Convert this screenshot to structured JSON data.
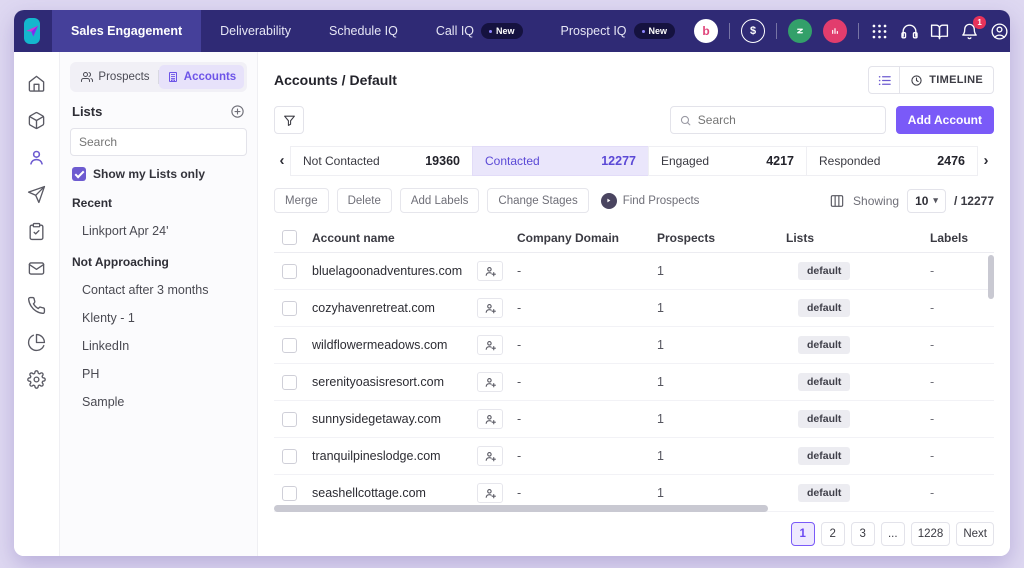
{
  "colors": {
    "accent": "#7a5af8",
    "navbar": "#2f2a75",
    "active_stage_text": "#5b49d6",
    "notification_red": "#e8335a"
  },
  "icon_names": [
    "paper-plane-logo",
    "dollar-icon",
    "zigzag-icon",
    "bars-icon",
    "grid-icon",
    "headset-icon",
    "book-icon",
    "bell-icon",
    "user-icon",
    "home-icon",
    "package-icon",
    "person-icon",
    "send-icon",
    "clipboard-icon",
    "mail-icon",
    "phone-icon",
    "pie-chart-icon",
    "gear-icon",
    "users-icon",
    "building-icon",
    "plus-circle-icon",
    "filter-icon",
    "search-icon",
    "list-view-icon",
    "clock-icon",
    "play-icon",
    "columns-icon",
    "user-plus-icon",
    "chevron-left-icon",
    "chevron-right-icon",
    "caret-down-icon"
  ],
  "topnav": {
    "items": [
      {
        "label": "Sales Engagement"
      },
      {
        "label": "Deliverability"
      },
      {
        "label": "Schedule IQ"
      },
      {
        "label": "Call IQ",
        "badge": "New"
      },
      {
        "label": "Prospect IQ",
        "badge": "New"
      }
    ],
    "apps": {
      "brand_letter": "b",
      "dollar": "$"
    },
    "notification_count": "1"
  },
  "sidebar": {
    "tabs": {
      "prospects": "Prospects",
      "accounts": "Accounts"
    },
    "lists_title": "Lists",
    "search_placeholder": "Search",
    "show_my_lists_label": "Show my Lists only",
    "sections": [
      {
        "title": "Recent",
        "items": [
          "Linkport Apr 24'"
        ]
      },
      {
        "title": "Not Approaching",
        "items": [
          "Contact after 3 months",
          "Klenty - 1",
          "LinkedIn",
          "PH",
          "Sample"
        ]
      }
    ]
  },
  "main": {
    "breadcrumb": "Accounts / Default",
    "timeline_label": "TIMELINE",
    "search_placeholder": "Search",
    "add_account_label": "Add Account",
    "stages": [
      {
        "label": "Not Contacted",
        "count": "19360"
      },
      {
        "label": "Contacted",
        "count": "12277"
      },
      {
        "label": "Engaged",
        "count": "4217"
      },
      {
        "label": "Responded",
        "count": "2476"
      }
    ],
    "actions": [
      "Merge",
      "Delete",
      "Add Labels",
      "Change Stages"
    ],
    "find_prospects_label": "Find Prospects",
    "showing": {
      "label": "Showing",
      "page_size": "10",
      "total": "/ 12277"
    },
    "table": {
      "columns": [
        "Account name",
        "Company Domain",
        "Prospects",
        "Lists",
        "Labels"
      ],
      "rows": [
        {
          "name": "bluelagoonadventures.com",
          "domain": "-",
          "prospects": "1",
          "list": "default",
          "labels": "-"
        },
        {
          "name": "cozyhavenretreat.com",
          "domain": "-",
          "prospects": "1",
          "list": "default",
          "labels": "-"
        },
        {
          "name": "wildflowermeadows.com",
          "domain": "-",
          "prospects": "1",
          "list": "default",
          "labels": "-"
        },
        {
          "name": "serenityoasisresort.com",
          "domain": "-",
          "prospects": "1",
          "list": "default",
          "labels": "-"
        },
        {
          "name": "sunnysidegetaway.com",
          "domain": "-",
          "prospects": "1",
          "list": "default",
          "labels": "-"
        },
        {
          "name": "tranquilpineslodge.com",
          "domain": "-",
          "prospects": "1",
          "list": "default",
          "labels": "-"
        },
        {
          "name": "seashellcottage.com",
          "domain": "-",
          "prospects": "1",
          "list": "default",
          "labels": "-"
        }
      ]
    },
    "pagination": {
      "pages": [
        "1",
        "2",
        "3",
        "...",
        "1228"
      ],
      "next": "Next"
    }
  }
}
